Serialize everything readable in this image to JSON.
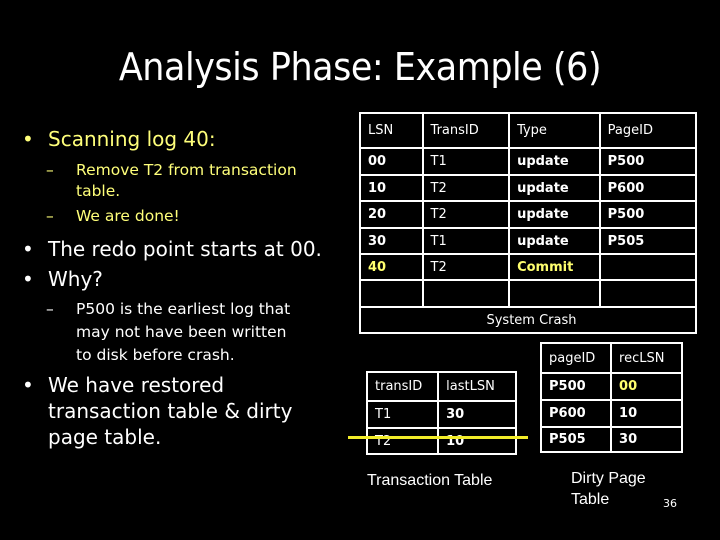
{
  "slide": {
    "title": "Analysis Phase: Example (6)",
    "page_number": "36"
  },
  "bullets": {
    "dot": "•",
    "dash": "–",
    "b1": {
      "text": "Scanning log 40:",
      "color": "#ffff7a"
    },
    "b1_sub1_line1": "Remove T2 from transaction",
    "b1_sub1_line2": "table.",
    "b1_sub2": "We are done!",
    "b2": "The redo point starts at 00.",
    "b3": "Why?",
    "b3_sub1_line1": "P500 is the earliest log that",
    "b3_sub1_line2": "may not have been written",
    "b3_sub1_line3": "to disk before crash.",
    "b4_line1": "We have restored",
    "b4_line2": "transaction table & dirty",
    "b4_line3": "page table."
  },
  "log_table": {
    "headers": [
      "LSN",
      "TransID",
      "Type",
      "PageID"
    ],
    "rows": [
      [
        "00",
        "T1",
        "update",
        "P500"
      ],
      [
        "10",
        "T2",
        "update",
        "P600"
      ],
      [
        "20",
        "T2",
        "update",
        "P500"
      ],
      [
        "30",
        "T1",
        "update",
        "P505"
      ],
      [
        "40",
        "T2",
        "Commit",
        ""
      ],
      [
        "",
        "",
        "",
        ""
      ]
    ],
    "footer": "System Crash"
  },
  "transaction_table": {
    "caption": "Transaction Table",
    "headers": [
      "transID",
      "lastLSN"
    ],
    "rows": [
      [
        "T1",
        "30"
      ],
      [
        "T2",
        "10"
      ]
    ],
    "struck_row": "T2"
  },
  "dirty_page_table": {
    "caption_line1": "Dirty Page",
    "caption_line2": "Table",
    "headers": [
      "pageID",
      "recLSN"
    ],
    "rows": [
      [
        "P500",
        "00"
      ],
      [
        "P600",
        "10"
      ],
      [
        "P505",
        "30"
      ]
    ]
  },
  "colors": {
    "highlight_text": "#ffff7a",
    "strike_line": "#f2ec29",
    "background": "#000000"
  }
}
